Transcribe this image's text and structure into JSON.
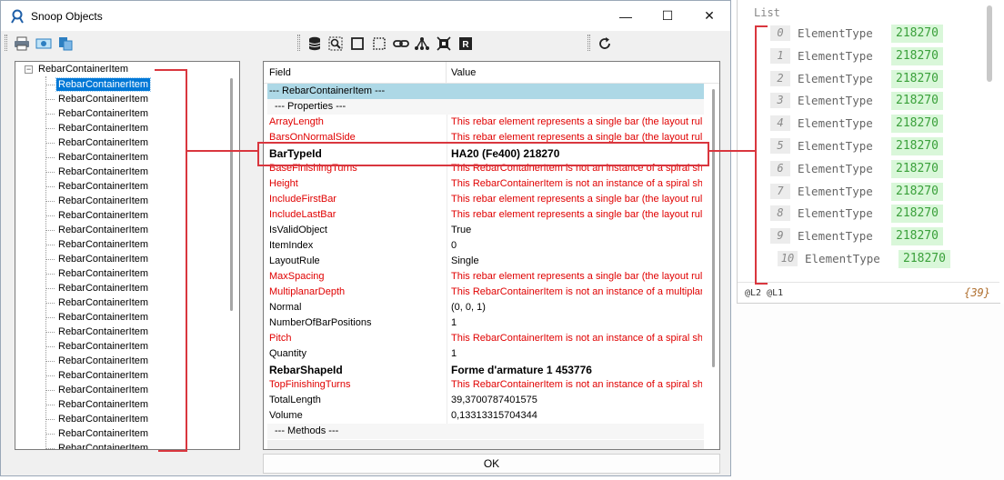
{
  "window": {
    "title": "Snoop Objects",
    "minimize_glyph": "—",
    "maximize_glyph": "☐",
    "close_glyph": "✕"
  },
  "toolbar": {
    "icons": [
      "printer-icon",
      "print-preview-icon",
      "copy-icon",
      "database-icon",
      "zoom-select-icon",
      "rectangle-icon",
      "dotted-rectangle-icon",
      "link-icon",
      "hierarchy-icon",
      "snoop-element-icon",
      "revit-icon",
      "refresh-icon"
    ]
  },
  "tree": {
    "root": "RebarContainerItem",
    "expander": "−",
    "items": [
      "RebarContainerItem",
      "RebarContainerItem",
      "RebarContainerItem",
      "RebarContainerItem",
      "RebarContainerItem",
      "RebarContainerItem",
      "RebarContainerItem",
      "RebarContainerItem",
      "RebarContainerItem",
      "RebarContainerItem",
      "RebarContainerItem",
      "RebarContainerItem",
      "RebarContainerItem",
      "RebarContainerItem",
      "RebarContainerItem",
      "RebarContainerItem",
      "RebarContainerItem",
      "RebarContainerItem",
      "RebarContainerItem",
      "RebarContainerItem",
      "RebarContainerItem",
      "RebarContainerItem",
      "RebarContainerItem",
      "RebarContainerItem",
      "RebarContainerItem",
      "RebarContainerItem"
    ],
    "selected_index": 0
  },
  "grid": {
    "headers": {
      "field": "Field",
      "value": "Value"
    },
    "rows": [
      {
        "field": "--- RebarContainerItem ---",
        "value": "",
        "style": "class"
      },
      {
        "field": "--- Properties ---",
        "value": "",
        "style": "group"
      },
      {
        "field": "ArrayLength",
        "value": "This rebar element represents a single bar (the layout rule is",
        "style": "red"
      },
      {
        "field": "BarsOnNormalSide",
        "value": "This rebar element represents a single bar (the layout rule is",
        "style": "red"
      },
      {
        "field": "BarTypeId",
        "value": "HA20 (Fe400)  218270",
        "style": "bold"
      },
      {
        "field": "BaseFinishingTurns",
        "value": "This RebarContainerItem is not an instance of a spiral shap",
        "style": "red"
      },
      {
        "field": "Height",
        "value": "This RebarContainerItem is not an instance of a spiral shap",
        "style": "red"
      },
      {
        "field": "IncludeFirstBar",
        "value": "This rebar element represents a single bar (the layout rule is",
        "style": "red"
      },
      {
        "field": "IncludeLastBar",
        "value": "This rebar element represents a single bar (the layout rule is",
        "style": "red"
      },
      {
        "field": "IsValidObject",
        "value": "True",
        "style": "normal"
      },
      {
        "field": "ItemIndex",
        "value": "0",
        "style": "normal"
      },
      {
        "field": "LayoutRule",
        "value": "Single",
        "style": "normal"
      },
      {
        "field": "MaxSpacing",
        "value": "This rebar element represents a single bar (the layout rule is",
        "style": "red"
      },
      {
        "field": "MultiplanarDepth",
        "value": "This RebarContainerItem is not an instance of a multiplanar",
        "style": "red"
      },
      {
        "field": "Normal",
        "value": "(0, 0, 1)",
        "style": "normal"
      },
      {
        "field": "NumberOfBarPositions",
        "value": "1",
        "style": "normal"
      },
      {
        "field": "Pitch",
        "value": "This RebarContainerItem is not an instance of a spiral shap",
        "style": "red"
      },
      {
        "field": "Quantity",
        "value": "1",
        "style": "normal"
      },
      {
        "field": "RebarShapeId",
        "value": "Forme d'armature 1  453776",
        "style": "bold"
      },
      {
        "field": "TopFinishingTurns",
        "value": "This RebarContainerItem is not an instance of a spiral shap",
        "style": "red"
      },
      {
        "field": "TotalLength",
        "value": "39,3700787401575",
        "style": "normal"
      },
      {
        "field": "Volume",
        "value": "0,13313315704344",
        "style": "normal"
      },
      {
        "field": "--- Methods ---",
        "value": "",
        "style": "group"
      }
    ]
  },
  "ok_label": "OK",
  "debug": {
    "header": "List",
    "rows": [
      {
        "index": "0",
        "key": "ElementType",
        "value": "218270"
      },
      {
        "index": "1",
        "key": "ElementType",
        "value": "218270"
      },
      {
        "index": "2",
        "key": "ElementType",
        "value": "218270"
      },
      {
        "index": "3",
        "key": "ElementType",
        "value": "218270"
      },
      {
        "index": "4",
        "key": "ElementType",
        "value": "218270"
      },
      {
        "index": "5",
        "key": "ElementType",
        "value": "218270"
      },
      {
        "index": "6",
        "key": "ElementType",
        "value": "218270"
      },
      {
        "index": "7",
        "key": "ElementType",
        "value": "218270"
      },
      {
        "index": "8",
        "key": "ElementType",
        "value": "218270"
      },
      {
        "index": "9",
        "key": "ElementType",
        "value": "218270"
      },
      {
        "index": "10",
        "key": "ElementType",
        "value": "218270"
      }
    ],
    "footer_left": "@L2 @L1",
    "footer_right": "{39}"
  },
  "colors": {
    "selection": "#0078d7",
    "error_text": "#e00000",
    "class_row": "#add8e6",
    "callout": "#d9363e",
    "value_badge": "#d9f7d9",
    "value_text": "#3aa03a"
  }
}
